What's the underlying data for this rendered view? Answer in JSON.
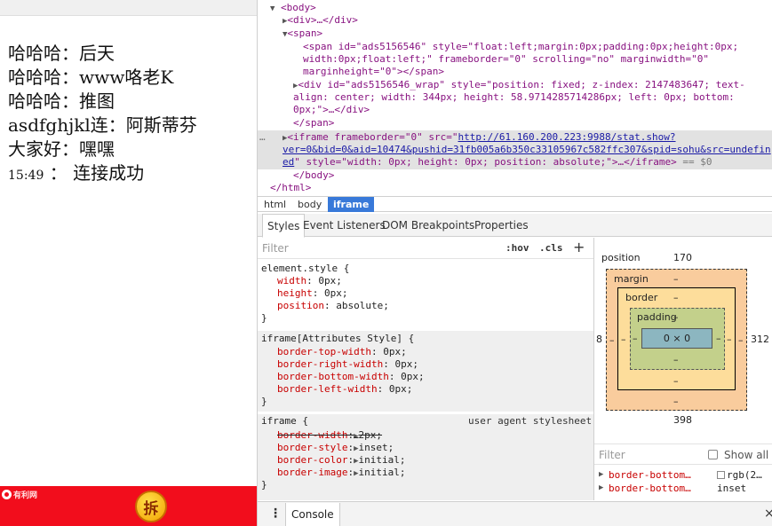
{
  "left_panel": {
    "messages": [
      {
        "time": "",
        "text": "哈哈哈：后天"
      },
      {
        "time": "",
        "text": "哈哈哈：www咯老K"
      },
      {
        "time": "",
        "text": "哈哈哈：推图"
      },
      {
        "time": "",
        "text": "asdfghjkl连：阿斯蒂芬"
      },
      {
        "time": "",
        "text": "大家好：嘿嘿"
      },
      {
        "time": "15:49",
        "text": "： 连接成功"
      }
    ],
    "ad_bar": {
      "logo_text": "有利网",
      "coin_text": "拆",
      "color": "#f20d1c"
    }
  },
  "elements": {
    "lines": {
      "body_open": "<body>",
      "div_collapsed": "<div>…</div>",
      "span_open": "<span>",
      "inner_span_1": "<span id=\"ads5156546\" style=\"float:left;margin:0px;padding:0px;height:0px;",
      "inner_span_2": "width:0px;float:left;\" frameborder=\"0\" scrolling=\"no\" marginwidth=\"0\"",
      "inner_span_3": "marginheight=\"0\"></span>",
      "div_wrap_1": "<div id=\"ads5156546_wrap\" style=\"position: fixed; z-index: 2147483647; text-",
      "div_wrap_2": "align: center; width: 344px; height: 58.9714285714286px; left: 0px; bottom:",
      "div_wrap_3": "0px;\">…</div>",
      "span_close": "</span>",
      "iframe_1a": "<iframe frameborder=\"0\" src=\"",
      "iframe_url_1": "http://61.160.200.223:9988/stat.show?",
      "iframe_url_2": "ver=0&bid=0&aid=10474&pushid=31fb005a6b350c33105967c582ffc307&spid=sohu&src=undefin",
      "iframe_url_3": "ed",
      "iframe_3b": "\" style=\"width: 0px; height: 0px; position: absolute;\">…</iframe>",
      "iframe_eq": "== $0",
      "body_close": "</body>",
      "html_close": "</html>",
      "dots": "…"
    }
  },
  "breadcrumbs": [
    {
      "label": "html",
      "selected": false
    },
    {
      "label": "body",
      "selected": false
    },
    {
      "label": "iframe",
      "selected": true
    }
  ],
  "tabs": [
    {
      "label": "Styles",
      "active": true
    },
    {
      "label": "Event Listeners",
      "active": false
    },
    {
      "label": "DOM Breakpoints",
      "active": false
    },
    {
      "label": "Properties",
      "active": false
    }
  ],
  "styles_pane": {
    "filter_placeholder": "Filter",
    "hov": ":hov",
    "cls": ".cls",
    "plus": "+",
    "rules": {
      "element_style": {
        "selector": "element.style {",
        "props": [
          {
            "name": "width",
            "value": "0px;"
          },
          {
            "name": "height",
            "value": "0px;"
          },
          {
            "name": "position",
            "value": "absolute;"
          }
        ],
        "close": "}"
      },
      "attributes_style": {
        "selector": "iframe[Attributes Style] {",
        "props": [
          {
            "name": "border-top-width",
            "value": "0px;"
          },
          {
            "name": "border-right-width",
            "value": "0px;"
          },
          {
            "name": "border-bottom-width",
            "value": "0px;"
          },
          {
            "name": "border-left-width",
            "value": "0px;"
          }
        ],
        "close": "}"
      },
      "user_agent": {
        "selector": "iframe {",
        "source": "user agent stylesheet",
        "props": [
          {
            "name": "border-width",
            "value": "2px;",
            "struck": true
          },
          {
            "name": "border-style",
            "value": "inset;"
          },
          {
            "name": "border-color",
            "value": "initial;"
          },
          {
            "name": "border-image",
            "value": "initial;"
          }
        ],
        "close": "}"
      }
    }
  },
  "box_model": {
    "position_label": "position",
    "position_top": "170",
    "position_left": "8",
    "position_right": "312",
    "position_bottom": "398",
    "margin_label": "margin",
    "margin_top": "–",
    "margin_left": "–",
    "margin_right": "–",
    "margin_bottom": "–",
    "border_label": "border",
    "border_top": "–",
    "border_left": "–",
    "border_right": "–",
    "border_bottom": "–",
    "padding_label": "padding",
    "padding_top": "–",
    "padding_left": "–",
    "padding_right": "–",
    "padding_bottom": "–",
    "content_size": "0 × 0"
  },
  "computed": {
    "filter_placeholder": "Filter",
    "show_all": "Show all",
    "rows": [
      {
        "prop": "border-bottom…",
        "value": "rgb(2…"
      },
      {
        "prop": "border-bottom…",
        "value": "inset"
      }
    ]
  },
  "drawer": {
    "dots": "⋮",
    "tab": "Console",
    "close": "×"
  },
  "colors": {
    "accent": "#3879d9",
    "tag": "#881280",
    "attr_name": "#994500",
    "attr_value": "#1a1aa6",
    "css_prop": "#c80000"
  }
}
